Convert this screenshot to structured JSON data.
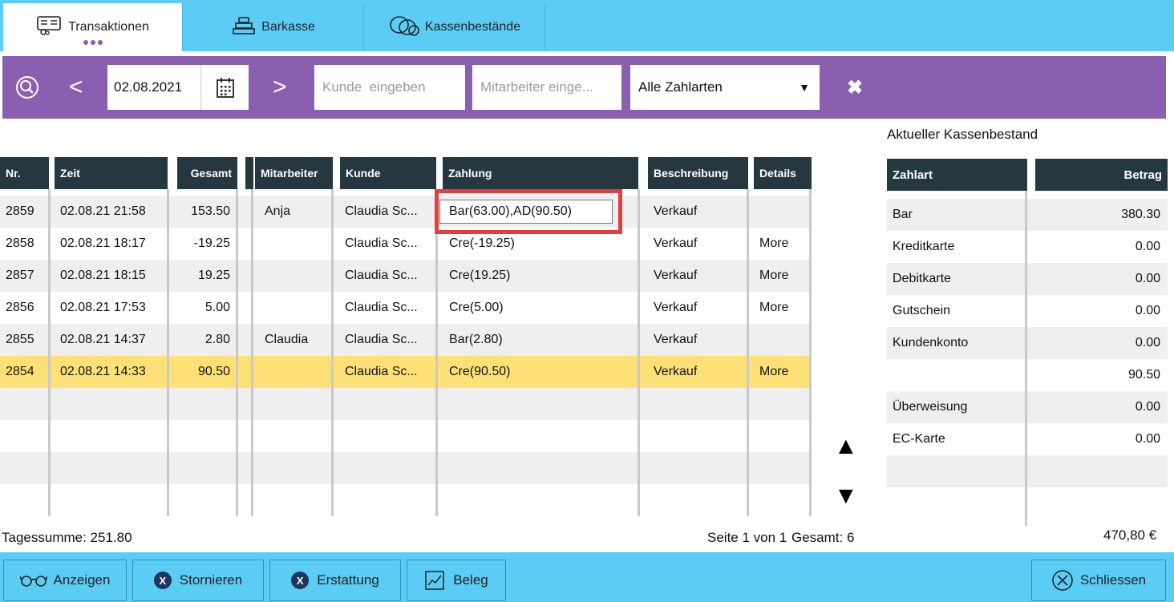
{
  "tabs": [
    {
      "label": "Transaktionen",
      "icon": "receipt-icon",
      "active": true
    },
    {
      "label": "Barkasse",
      "icon": "cash-register-icon",
      "active": false
    },
    {
      "label": "Kassenbestände",
      "icon": "coins-icon",
      "active": false
    }
  ],
  "filter": {
    "date": "02.08.2021",
    "customer_placeholder": "Kunde  eingeben",
    "employee_placeholder": "Mitarbeiter einge...",
    "payment_select": "Alle Zahlarten",
    "dropdown_arrow": "▼",
    "prev_arrow": "<",
    "next_arrow": ">",
    "clear_glyph": "✖"
  },
  "table": {
    "headers": [
      "Nr.",
      "Zeit",
      "Gesamt",
      "Mitarbeiter",
      "Kunde",
      "Zahlung",
      "Beschreibung",
      "Details"
    ],
    "rows": [
      {
        "nr": "2859",
        "zeit": "02.08.21 21:58",
        "gesamt": "153.50",
        "mitarbeiter": "Anja",
        "kunde": "Claudia  Sc...",
        "zahlung": "Bar(63.00),AD(90.50)",
        "beschreibung": "Verkauf",
        "details": ""
      },
      {
        "nr": "2858",
        "zeit": "02.08.21 18:17",
        "gesamt": "-19.25",
        "mitarbeiter": "",
        "kunde": "Claudia  Sc...",
        "zahlung": "Cre(-19.25)",
        "beschreibung": "Verkauf",
        "details": "More"
      },
      {
        "nr": "2857",
        "zeit": "02.08.21 18:15",
        "gesamt": "19.25",
        "mitarbeiter": "",
        "kunde": "Claudia  Sc...",
        "zahlung": "Cre(19.25)",
        "beschreibung": "Verkauf",
        "details": "More"
      },
      {
        "nr": "2856",
        "zeit": "02.08.21 17:53",
        "gesamt": "5.00",
        "mitarbeiter": "",
        "kunde": "Claudia  Sc...",
        "zahlung": "Cre(5.00)",
        "beschreibung": "Verkauf",
        "details": "More"
      },
      {
        "nr": "2855",
        "zeit": "02.08.21 14:37",
        "gesamt": "2.80",
        "mitarbeiter": "Claudia",
        "kunde": "Claudia  Sc...",
        "zahlung": "Bar(2.80)",
        "beschreibung": "Verkauf",
        "details": ""
      },
      {
        "nr": "2854",
        "zeit": "02.08.21 14:33",
        "gesamt": "90.50",
        "mitarbeiter": "",
        "kunde": "Claudia  Sc...",
        "zahlung": "Cre(90.50)",
        "beschreibung": "Verkauf",
        "details": "More"
      }
    ],
    "selected_row_color": "#fde176",
    "scroll_up": "▲",
    "scroll_down": "▼"
  },
  "cash_panel": {
    "title": "Aktueller Kassenbestand",
    "headers": [
      "Zahlart",
      "Betrag"
    ],
    "rows": [
      {
        "zahlart": "Bar",
        "betrag": "380.30"
      },
      {
        "zahlart": "Kreditkarte",
        "betrag": "0.00"
      },
      {
        "zahlart": "Debitkarte",
        "betrag": "0.00"
      },
      {
        "zahlart": "Gutschein",
        "betrag": "0.00"
      },
      {
        "zahlart": "Kundenkonto",
        "betrag": "0.00"
      },
      {
        "zahlart": "",
        "betrag": "90.50"
      },
      {
        "zahlart": "Überweisung",
        "betrag": "0.00"
      },
      {
        "zahlart": "EC-Karte",
        "betrag": "0.00"
      }
    ],
    "total": "470,80 €"
  },
  "footer": {
    "tagessumme": "Tagessumme: 251.80",
    "seite": "Seite 1 von 1",
    "gesamt": "Gesamt: 6"
  },
  "buttons": {
    "anzeigen": "Anzeigen",
    "stornieren": "Stornieren",
    "erstattung": "Erstattung",
    "beleg": "Beleg",
    "schliessen": "Schliessen",
    "x_glyph": "X"
  },
  "colors": {
    "accent_purple": "#8b5faf",
    "header_dark": "#253840",
    "bar_blue": "#5bcdf5",
    "highlight_red": "#e53c3c"
  }
}
